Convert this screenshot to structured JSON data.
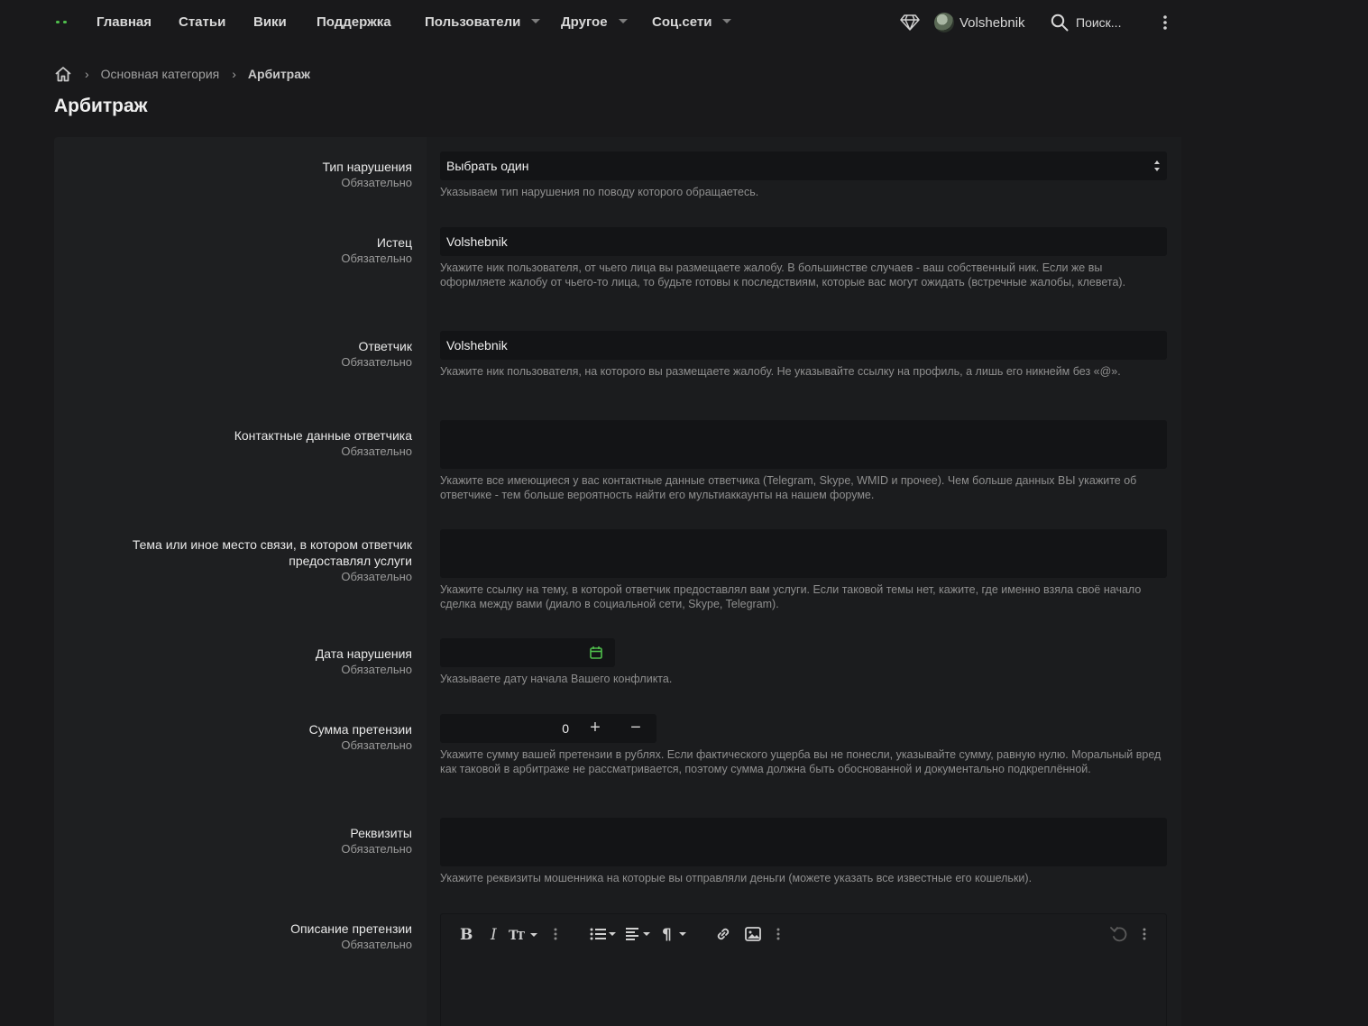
{
  "nav": {
    "items": [
      {
        "label": "Главная"
      },
      {
        "label": "Статьи"
      },
      {
        "label": "Вики"
      },
      {
        "label": "Поддержка"
      },
      {
        "label": "Пользователи"
      },
      {
        "label": "Другое"
      },
      {
        "label": "Соц.сети"
      }
    ],
    "username": "Volshebnik",
    "search_label": "Поиск..."
  },
  "breadcrumb": {
    "items": [
      "Основная категория",
      "Арбитраж"
    ]
  },
  "page_title": "Арбитраж",
  "form": {
    "required_text": "Обязательно",
    "fields": [
      {
        "label": "Тип нарушения",
        "value": "Выбрать один",
        "hint": "Указываем тип нарушения по поводу которого обращаетесь."
      },
      {
        "label": "Истец",
        "value": "Volshebnik",
        "hint": "Укажите ник пользователя, от чьего лица вы размещаете жалобу. В большинстве случаев - ваш собственный ник. Если же вы оформляете жалобу от чьего-то лица, то будьте готовы к последствиям, которые вас могут ожидать (встречные жалобы, клевета)."
      },
      {
        "label": "Ответчик",
        "value": "Volshebnik",
        "hint": "Укажите ник пользователя, на которого вы размещаете жалобу. Не указывайте ссылку на профиль, а лишь его никнейм без «@»."
      },
      {
        "label": "Контактные данные ответчика",
        "value": "",
        "hint": "Укажите все имеющиеся у вас контактные данные ответчика (Telegram, Skype, WMID и прочее). Чем больше данных ВЫ укажите об ответчике - тем больше вероятность найти его мультиаккаунты на нашем форуме."
      },
      {
        "label_line1": "Тема или иное место связи, в котором ответчик",
        "label_line2": "предоставлял услуги",
        "value": "",
        "hint": "Укажите ссылку на тему, в которой ответчик предоставлял вам услуги. Если таковой темы нет, кажите, где именно взяла своё начало сделка между вами (диало в социальной сети, Skype, Telegram)."
      },
      {
        "label": "Дата нарушения",
        "value": "",
        "hint": "Указываете дату начала Вашего конфликта."
      },
      {
        "label": "Сумма претензии",
        "value": "0",
        "hint": "Укажите сумму вашей претензии в рублях. Если фактического ущерба вы не понесли, указывайте сумму, равную нулю. Моральный вред как таковой в арбитраже не рассматривается, поэтому сумма должна быть обоснованной и документально подкреплённой."
      },
      {
        "label": "Реквизиты",
        "value": "",
        "hint": "Укажите реквизиты мошенника на которые вы отправляли деньги (можете указать все известные его кошельки)."
      },
      {
        "label": "Описание претензии",
        "value": ""
      }
    ]
  },
  "colors": {
    "accent": "#4fbf4c",
    "background": "#19191b",
    "panel": "#1e1f21",
    "input": "#131416"
  }
}
